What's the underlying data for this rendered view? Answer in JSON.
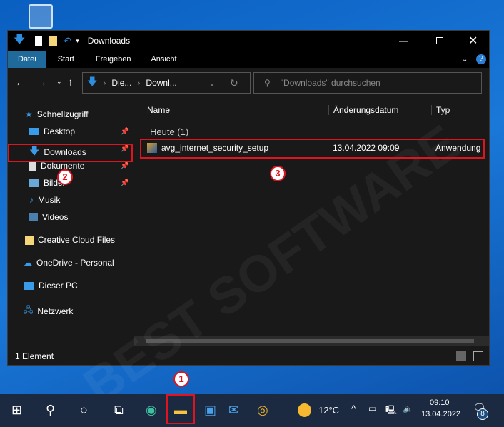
{
  "window": {
    "title": "Downloads"
  },
  "ribbon": {
    "tabs": [
      "Datei",
      "Start",
      "Freigeben",
      "Ansicht"
    ]
  },
  "address": {
    "crumbs": [
      "Die...",
      "Downl..."
    ],
    "search_placeholder": "\"Downloads\" durchsuchen"
  },
  "sidebar": {
    "items": [
      {
        "label": "Schnellzugriff",
        "icon": "star-icon"
      },
      {
        "label": "Desktop",
        "icon": "desktop-icon"
      },
      {
        "label": "Downloads",
        "icon": "download-icon"
      },
      {
        "label": "Dokumente",
        "icon": "document-icon"
      },
      {
        "label": "Bilder",
        "icon": "pictures-icon"
      },
      {
        "label": "Musik",
        "icon": "music-icon"
      },
      {
        "label": "Videos",
        "icon": "video-icon"
      },
      {
        "label": "Creative Cloud Files",
        "icon": "cc-icon"
      },
      {
        "label": "OneDrive - Personal",
        "icon": "cloud-icon"
      },
      {
        "label": "Dieser PC",
        "icon": "pc-icon"
      },
      {
        "label": "Netzwerk",
        "icon": "network-icon"
      }
    ]
  },
  "columns": [
    "Name",
    "Änderungsdatum",
    "Typ"
  ],
  "group": "Heute (1)",
  "files": [
    {
      "name": "avg_internet_security_setup",
      "date": "13.04.2022 09:09",
      "type": "Anwendung"
    }
  ],
  "status": {
    "count": "1 Element"
  },
  "taskbar": {
    "temp": "12°C",
    "time": "09:10",
    "date": "13.04.2022",
    "notifications": "8"
  },
  "annotations": [
    "1",
    "2",
    "3"
  ],
  "watermark": "BEST SOFTWARE",
  "colors": {
    "accent": "#1f6a9a",
    "annotation": "#e0141e"
  }
}
